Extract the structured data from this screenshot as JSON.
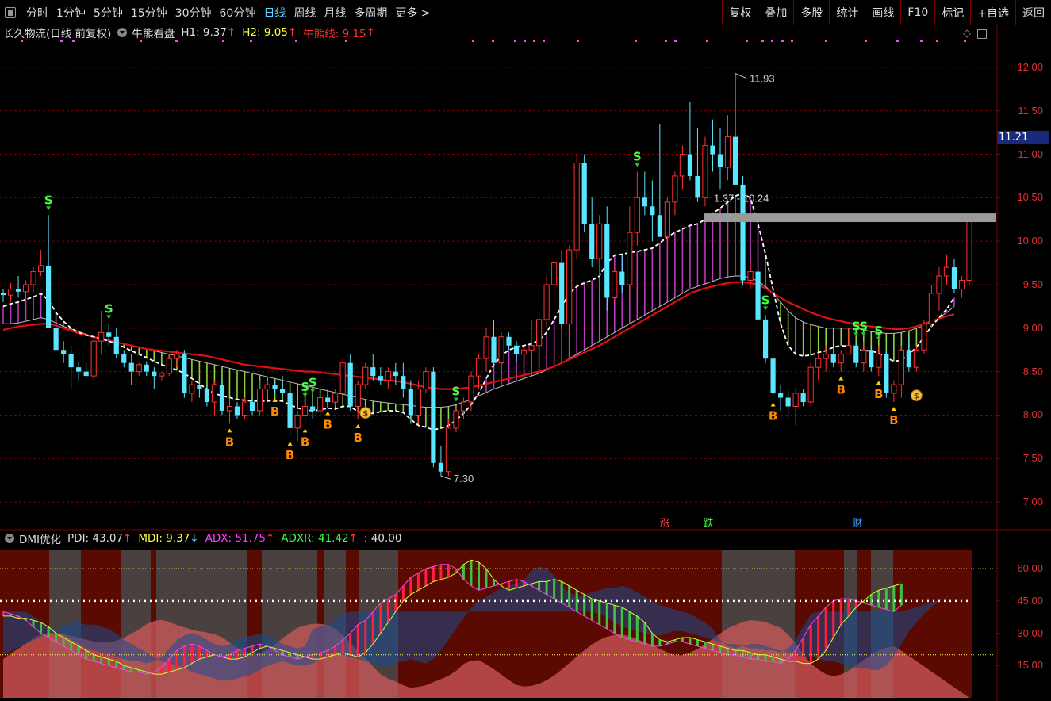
{
  "toolbar": {
    "periods": [
      "分时",
      "1分钟",
      "5分钟",
      "15分钟",
      "30分钟",
      "60分钟",
      "日线",
      "周线",
      "月线",
      "多周期",
      "更多 >"
    ],
    "active_period": "日线",
    "buttons": [
      "复权",
      "叠加",
      "多股",
      "统计",
      "画线",
      "F10",
      "标记",
      "+自选",
      "返回"
    ]
  },
  "stock": {
    "title": "长久物流(日线 前复权)",
    "indicator_name": "牛熊看盘",
    "h1_label": "H1: 9.37",
    "h2_label": "H2: 9.05",
    "bull_bear_label": "牛熊线: 9.15",
    "current_price_tag": "11.21"
  },
  "colors": {
    "background": "#000000",
    "up": "#ff3030",
    "down": "#5ae6ff",
    "bull_fill": "#cc44cc",
    "bear_fill": "#99ee44",
    "red_line": "#e01010",
    "axis_text": "#e03030",
    "grid": "#7a0000"
  },
  "price_axis": {
    "ticks": [
      "12.00",
      "11.50",
      "11.00",
      "10.50",
      "10.00",
      "9.50",
      "9.00",
      "8.50",
      "8.00",
      "7.50",
      "7.00"
    ]
  },
  "annotations": {
    "high": "11.93",
    "low": "7.30",
    "range": "1.37 - 10.24",
    "zhang": "涨",
    "die": "跌",
    "cai": "财",
    "sell_letter": "S",
    "buy_letter": "B"
  },
  "dmi": {
    "name": "DMI优化",
    "pdi": "PDI: 43.07",
    "mdi": "MDI: 9.37",
    "adx": "ADX: 51.75",
    "adxr": "ADXR: 41.42",
    "level": ": 40.00",
    "ticks": [
      "60.00",
      "45.00",
      "30.00",
      "15.00"
    ]
  },
  "chart_data": {
    "type": "candlestick",
    "ylim": [
      6.7,
      12.3
    ],
    "candles": [
      [
        9.4,
        9.45,
        9.3,
        9.38
      ],
      [
        9.38,
        9.52,
        9.3,
        9.45
      ],
      [
        9.45,
        9.6,
        9.35,
        9.42
      ],
      [
        9.42,
        9.55,
        9.3,
        9.5
      ],
      [
        9.5,
        9.7,
        9.4,
        9.65
      ],
      [
        9.65,
        9.9,
        9.6,
        9.72
      ],
      [
        9.72,
        10.3,
        9.0,
        9.0
      ],
      [
        9.0,
        9.2,
        8.85,
        8.75
      ],
      [
        8.75,
        8.85,
        8.6,
        8.7
      ],
      [
        8.7,
        8.8,
        8.3,
        8.55
      ],
      [
        8.55,
        8.62,
        8.4,
        8.5
      ],
      [
        8.5,
        8.6,
        8.45,
        8.45
      ],
      [
        8.45,
        8.9,
        8.4,
        8.85
      ],
      [
        8.85,
        9.2,
        8.7,
        8.95
      ],
      [
        8.95,
        9.05,
        8.8,
        8.9
      ],
      [
        8.9,
        9.0,
        8.65,
        8.7
      ],
      [
        8.7,
        8.75,
        8.55,
        8.6
      ],
      [
        8.6,
        8.7,
        8.35,
        8.5
      ],
      [
        8.5,
        8.6,
        8.45,
        8.58
      ],
      [
        8.58,
        8.62,
        8.45,
        8.5
      ],
      [
        8.5,
        8.55,
        8.3,
        8.45
      ],
      [
        8.45,
        8.5,
        8.4,
        8.48
      ],
      [
        8.48,
        8.7,
        8.45,
        8.65
      ],
      [
        8.65,
        8.75,
        8.55,
        8.7
      ],
      [
        8.7,
        8.75,
        8.2,
        8.25
      ],
      [
        8.25,
        8.4,
        8.15,
        8.35
      ],
      [
        8.35,
        8.45,
        8.2,
        8.3
      ],
      [
        8.3,
        8.35,
        8.1,
        8.15
      ],
      [
        8.15,
        8.4,
        8.0,
        8.35
      ],
      [
        8.35,
        8.4,
        8.0,
        8.05
      ],
      [
        8.05,
        8.2,
        7.9,
        8.1
      ],
      [
        8.1,
        8.15,
        7.95,
        8.0
      ],
      [
        8.0,
        8.2,
        7.95,
        8.15
      ],
      [
        8.15,
        8.2,
        8.0,
        8.05
      ],
      [
        8.05,
        8.4,
        8.0,
        8.3
      ],
      [
        8.3,
        8.4,
        8.2,
        8.35
      ],
      [
        8.35,
        8.4,
        8.25,
        8.3
      ],
      [
        8.3,
        8.45,
        8.2,
        8.25
      ],
      [
        8.25,
        8.3,
        7.75,
        7.85
      ],
      [
        7.85,
        8.05,
        7.7,
        8.0
      ],
      [
        8.0,
        8.15,
        7.9,
        8.1
      ],
      [
        8.1,
        8.2,
        7.95,
        8.05
      ],
      [
        8.05,
        8.25,
        8.0,
        8.2
      ],
      [
        8.2,
        8.3,
        8.1,
        8.15
      ],
      [
        8.15,
        8.3,
        8.1,
        8.25
      ],
      [
        8.25,
        8.65,
        8.2,
        8.6
      ],
      [
        8.6,
        8.7,
        8.05,
        8.1
      ],
      [
        8.1,
        8.4,
        7.95,
        8.35
      ],
      [
        8.35,
        8.6,
        8.3,
        8.55
      ],
      [
        8.55,
        8.7,
        8.4,
        8.45
      ],
      [
        8.45,
        8.55,
        8.35,
        8.4
      ],
      [
        8.4,
        8.55,
        8.3,
        8.5
      ],
      [
        8.5,
        8.6,
        8.35,
        8.45
      ],
      [
        8.45,
        8.6,
        8.2,
        8.3
      ],
      [
        8.3,
        8.4,
        7.9,
        8.0
      ],
      [
        8.0,
        8.4,
        7.9,
        8.3
      ],
      [
        8.3,
        8.55,
        8.25,
        8.5
      ],
      [
        8.5,
        8.55,
        7.4,
        7.45
      ],
      [
        7.45,
        7.65,
        7.3,
        7.35
      ],
      [
        7.35,
        7.95,
        7.3,
        7.85
      ],
      [
        7.85,
        8.1,
        7.8,
        8.05
      ],
      [
        8.05,
        8.2,
        7.95,
        8.15
      ],
      [
        8.15,
        8.5,
        8.05,
        8.45
      ],
      [
        8.45,
        8.7,
        8.3,
        8.65
      ],
      [
        8.65,
        9.0,
        8.5,
        8.9
      ],
      [
        8.9,
        9.1,
        8.55,
        8.6
      ],
      [
        8.6,
        8.95,
        8.6,
        8.9
      ],
      [
        8.9,
        8.95,
        8.75,
        8.8
      ],
      [
        8.8,
        8.85,
        8.6,
        8.7
      ],
      [
        8.7,
        8.8,
        8.6,
        8.75
      ],
      [
        8.75,
        9.1,
        8.7,
        8.8
      ],
      [
        8.8,
        9.2,
        8.7,
        9.1
      ],
      [
        9.1,
        9.6,
        9.0,
        9.5
      ],
      [
        9.5,
        9.8,
        9.4,
        9.75
      ],
      [
        9.75,
        9.9,
        9.0,
        9.05
      ],
      [
        9.05,
        9.95,
        9.0,
        9.9
      ],
      [
        9.9,
        11.0,
        9.8,
        10.9
      ],
      [
        10.9,
        11.0,
        10.1,
        10.2
      ],
      [
        10.2,
        10.5,
        9.7,
        9.8
      ],
      [
        9.8,
        10.3,
        9.6,
        10.2
      ],
      [
        10.2,
        10.4,
        9.2,
        9.35
      ],
      [
        9.35,
        9.7,
        9.3,
        9.65
      ],
      [
        9.65,
        9.85,
        9.4,
        9.5
      ],
      [
        9.5,
        10.4,
        9.4,
        10.1
      ],
      [
        10.1,
        10.8,
        9.95,
        10.5
      ],
      [
        10.5,
        10.8,
        10.3,
        10.4
      ],
      [
        10.4,
        10.7,
        10.0,
        10.3
      ],
      [
        10.3,
        11.35,
        10.05,
        10.05
      ],
      [
        10.05,
        10.5,
        9.95,
        10.45
      ],
      [
        10.45,
        10.8,
        10.3,
        10.75
      ],
      [
        10.75,
        11.1,
        10.6,
        11.0
      ],
      [
        11.0,
        11.6,
        10.7,
        10.75
      ],
      [
        10.75,
        11.3,
        10.45,
        10.5
      ],
      [
        10.5,
        11.2,
        10.4,
        11.1
      ],
      [
        11.1,
        11.4,
        10.8,
        11.0
      ],
      [
        11.0,
        11.3,
        10.6,
        10.85
      ],
      [
        10.85,
        11.45,
        10.7,
        11.2
      ],
      [
        11.2,
        11.93,
        10.9,
        10.65
      ],
      [
        10.65,
        10.75,
        9.5,
        9.55
      ],
      [
        9.55,
        9.75,
        9.45,
        9.65
      ],
      [
        9.65,
        9.7,
        9.0,
        9.1
      ],
      [
        9.1,
        9.15,
        8.6,
        8.65
      ],
      [
        8.65,
        8.7,
        8.2,
        8.25
      ],
      [
        8.25,
        8.35,
        8.05,
        8.2
      ],
      [
        8.2,
        8.3,
        7.95,
        8.1
      ],
      [
        8.1,
        8.3,
        7.88,
        8.25
      ],
      [
        8.25,
        8.3,
        8.1,
        8.15
      ],
      [
        8.15,
        8.6,
        8.1,
        8.55
      ],
      [
        8.55,
        8.7,
        8.4,
        8.65
      ],
      [
        8.65,
        8.8,
        8.5,
        8.7
      ],
      [
        8.7,
        8.9,
        8.55,
        8.6
      ],
      [
        8.6,
        8.75,
        8.5,
        8.7
      ],
      [
        8.7,
        9.0,
        8.7,
        8.8
      ],
      [
        8.8,
        8.85,
        8.55,
        8.6
      ],
      [
        8.6,
        8.85,
        8.5,
        8.75
      ],
      [
        8.75,
        8.8,
        8.5,
        8.55
      ],
      [
        8.55,
        8.8,
        8.45,
        8.7
      ],
      [
        8.7,
        8.75,
        8.2,
        8.25
      ],
      [
        8.25,
        8.4,
        8.15,
        8.35
      ],
      [
        8.35,
        8.8,
        8.2,
        8.75
      ],
      [
        8.75,
        8.9,
        8.5,
        8.55
      ],
      [
        8.55,
        8.8,
        8.5,
        8.75
      ],
      [
        8.75,
        9.1,
        8.7,
        9.05
      ],
      [
        9.05,
        9.5,
        9.0,
        9.4
      ],
      [
        9.4,
        9.7,
        9.2,
        9.6
      ],
      [
        9.6,
        9.85,
        9.5,
        9.7
      ],
      [
        9.7,
        9.8,
        9.4,
        9.45
      ],
      [
        9.45,
        9.6,
        9.35,
        9.55
      ],
      [
        9.55,
        10.3,
        9.5,
        10.25
      ]
    ],
    "bull_line": [
      9.25,
      9.28,
      9.3,
      9.33,
      9.36,
      9.4,
      9.32,
      9.18,
      9.08,
      9.0,
      8.95,
      8.92,
      8.9,
      8.88,
      8.85,
      8.82,
      8.78,
      8.74,
      8.7,
      8.66,
      8.62,
      8.58,
      8.55,
      8.52,
      8.48,
      8.42,
      8.36,
      8.3,
      8.25,
      8.22,
      8.2,
      8.18,
      8.17,
      8.16,
      8.16,
      8.16,
      8.17,
      8.16,
      8.12,
      8.08,
      8.06,
      8.05,
      8.06,
      8.08,
      8.07,
      8.1,
      8.1,
      8.04,
      8.02,
      8.02,
      8.04,
      8.05,
      8.05,
      8.03,
      7.95,
      7.88,
      7.86,
      7.83,
      7.85,
      7.88,
      7.94,
      8.02,
      8.12,
      8.25,
      8.42,
      8.58,
      8.68,
      8.75,
      8.78,
      8.8,
      8.82,
      8.86,
      8.95,
      9.1,
      9.25,
      9.4,
      9.48,
      9.52,
      9.55,
      9.6,
      9.75,
      9.84,
      9.85,
      9.87,
      9.88,
      9.9,
      9.92,
      9.98,
      10.05,
      10.1,
      10.14,
      10.18,
      10.2,
      10.25,
      10.32,
      10.38,
      10.45,
      10.52,
      10.55,
      10.5,
      10.2,
      9.85,
      9.45,
      9.05,
      8.8,
      8.7,
      8.68,
      8.69,
      8.72,
      8.74,
      8.78,
      8.8,
      8.79,
      8.76,
      8.74,
      8.74,
      8.71,
      8.66,
      8.62,
      8.63,
      8.7,
      8.78,
      8.9,
      9.02,
      9.12,
      9.22,
      9.35
    ],
    "bear_line": [
      9.05,
      9.05,
      9.06,
      9.08,
      9.1,
      9.12,
      9.1,
      9.06,
      9.02,
      8.99,
      8.96,
      8.93,
      8.9,
      8.88,
      8.86,
      8.84,
      8.82,
      8.8,
      8.78,
      8.76,
      8.74,
      8.72,
      8.7,
      8.68,
      8.66,
      8.64,
      8.62,
      8.6,
      8.58,
      8.56,
      8.54,
      8.52,
      8.5,
      8.48,
      8.46,
      8.44,
      8.42,
      8.4,
      8.38,
      8.36,
      8.34,
      8.32,
      8.3,
      8.28,
      8.26,
      8.24,
      8.22,
      8.2,
      8.18,
      8.16,
      8.15,
      8.14,
      8.13,
      8.12,
      8.11,
      8.1,
      8.09,
      8.09,
      8.09,
      8.1,
      8.12,
      8.15,
      8.18,
      8.22,
      8.26,
      8.3,
      8.33,
      8.36,
      8.39,
      8.42,
      8.45,
      8.48,
      8.52,
      8.56,
      8.6,
      8.65,
      8.7,
      8.75,
      8.8,
      8.85,
      8.9,
      8.95,
      9.0,
      9.05,
      9.1,
      9.15,
      9.2,
      9.25,
      9.3,
      9.35,
      9.4,
      9.45,
      9.48,
      9.51,
      9.54,
      9.57,
      9.59,
      9.6,
      9.6,
      9.58,
      9.54,
      9.48,
      9.4,
      9.3,
      9.2,
      9.12,
      9.07,
      9.04,
      9.02,
      9.0,
      9.0,
      9.0,
      9.0,
      9.0,
      8.98,
      8.96,
      8.95,
      8.94,
      8.94,
      8.95,
      8.97,
      9.0,
      9.03,
      9.07,
      9.12,
      9.18,
      9.25
    ],
    "red_line": [
      8.98,
      9.0,
      9.02,
      9.03,
      9.04,
      9.05,
      9.05,
      9.03,
      9.0,
      8.97,
      8.94,
      8.92,
      8.9,
      8.88,
      8.86,
      8.84,
      8.82,
      8.8,
      8.78,
      8.76,
      8.75,
      8.74,
      8.73,
      8.72,
      8.71,
      8.7,
      8.69,
      8.68,
      8.66,
      8.64,
      8.62,
      8.6,
      8.58,
      8.57,
      8.56,
      8.55,
      8.54,
      8.53,
      8.52,
      8.51,
      8.5,
      8.5,
      8.49,
      8.48,
      8.47,
      8.46,
      8.45,
      8.44,
      8.43,
      8.42,
      8.41,
      8.4,
      8.39,
      8.38,
      8.36,
      8.34,
      8.32,
      8.31,
      8.3,
      8.3,
      8.3,
      8.31,
      8.32,
      8.34,
      8.36,
      8.38,
      8.4,
      8.42,
      8.44,
      8.46,
      8.48,
      8.5,
      8.53,
      8.56,
      8.6,
      8.64,
      8.68,
      8.72,
      8.76,
      8.8,
      8.85,
      8.9,
      8.95,
      9.0,
      9.05,
      9.1,
      9.15,
      9.2,
      9.25,
      9.3,
      9.35,
      9.4,
      9.43,
      9.46,
      9.48,
      9.5,
      9.52,
      9.53,
      9.53,
      9.52,
      9.5,
      9.46,
      9.4,
      9.35,
      9.3,
      9.26,
      9.22,
      9.18,
      9.15,
      9.12,
      9.1,
      9.08,
      9.06,
      9.04,
      9.03,
      9.02,
      9.01,
      9.0,
      8.99,
      8.99,
      9.0,
      9.02,
      9.05,
      9.08,
      9.11,
      9.14,
      9.16
    ],
    "sell_signals": [
      6,
      14,
      40,
      41,
      60,
      84,
      101,
      113,
      114,
      116
    ],
    "buy_signals": [
      30,
      36,
      38,
      40,
      43,
      47,
      102,
      111,
      116,
      118
    ],
    "money_bags": [
      48,
      121
    ],
    "dmi_series": {
      "adx": [
        38,
        38,
        37,
        37,
        36,
        35,
        33,
        30,
        28,
        26,
        24,
        22,
        20,
        19,
        18,
        17,
        15,
        14,
        13,
        12,
        11,
        11,
        12,
        13,
        14,
        16,
        18,
        19,
        20,
        19,
        18,
        18,
        19,
        21,
        23,
        24,
        23,
        22,
        21,
        20,
        19,
        18,
        18,
        19,
        20,
        21,
        20,
        19,
        21,
        25,
        30,
        35,
        40,
        45,
        48,
        50,
        52,
        54,
        55,
        56,
        58,
        62,
        64,
        63,
        60,
        55,
        52,
        50,
        51,
        52,
        53,
        54,
        54,
        55,
        54,
        52,
        50,
        48,
        46,
        45,
        44,
        43,
        42,
        40,
        38,
        35,
        30,
        27,
        26,
        27,
        28,
        28,
        27,
        26,
        25,
        24,
        23,
        22,
        22,
        21,
        20,
        20,
        19,
        18,
        17,
        17,
        16,
        16,
        18,
        22,
        28,
        34,
        38,
        42,
        45,
        48,
        50,
        51,
        52,
        53
      ],
      "pdi": [
        40,
        39,
        38,
        36,
        33,
        30,
        28,
        26,
        24,
        22,
        20,
        18,
        17,
        16,
        15,
        14,
        13,
        12,
        12,
        11,
        12,
        14,
        18,
        22,
        24,
        25,
        24,
        22,
        20,
        19,
        20,
        22,
        23,
        24,
        25,
        24,
        22,
        20,
        19,
        18,
        19,
        20,
        21,
        22,
        24,
        27,
        30,
        34,
        36,
        40,
        44,
        46,
        48,
        52,
        56,
        58,
        60,
        61,
        62,
        62,
        60,
        55,
        52,
        50,
        51,
        52,
        53,
        54,
        55,
        54,
        52,
        50,
        48,
        46,
        44,
        42,
        40,
        38,
        36,
        34,
        32,
        30,
        28,
        27,
        26,
        25,
        24,
        24,
        25,
        26,
        26,
        25,
        24,
        23,
        22,
        21,
        20,
        20,
        19,
        18,
        18,
        17,
        17,
        16,
        18,
        22,
        28,
        34,
        38,
        42,
        45,
        46,
        46,
        45,
        44,
        43,
        42,
        41,
        40,
        43
      ]
    }
  }
}
